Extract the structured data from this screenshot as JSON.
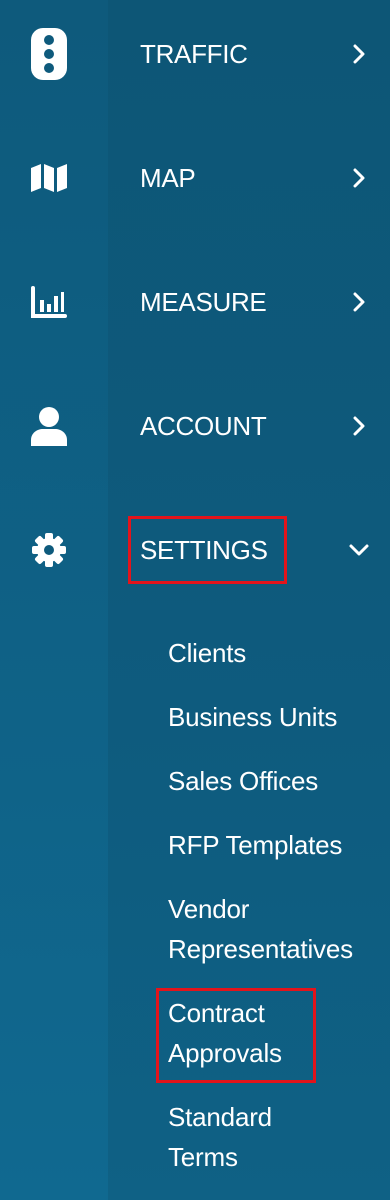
{
  "nav": {
    "items": [
      {
        "label": "TRAFFIC",
        "icon": "traffic-light-icon",
        "chevron": "chevron-right-icon"
      },
      {
        "label": "MAP",
        "icon": "map-icon",
        "chevron": "chevron-right-icon"
      },
      {
        "label": "MEASURE",
        "icon": "bar-chart-icon",
        "chevron": "chevron-right-icon"
      },
      {
        "label": "ACCOUNT",
        "icon": "user-icon",
        "chevron": "chevron-right-icon"
      },
      {
        "label": "SETTINGS",
        "icon": "gear-icon",
        "chevron": "chevron-down-icon",
        "expanded": true
      }
    ]
  },
  "settings_submenu": {
    "items": [
      {
        "label": "Clients"
      },
      {
        "label": "Business Units"
      },
      {
        "label": "Sales Offices"
      },
      {
        "label": "RFP Templates"
      },
      {
        "label": "Vendor Representatives",
        "line1": "Vendor",
        "line2": "Representatives"
      },
      {
        "label": "Contract Approvals",
        "line1": "Contract",
        "line2": "Approvals"
      },
      {
        "label": "Standard Terms",
        "line1": "Standard",
        "line2": "Terms"
      }
    ]
  },
  "colors": {
    "highlight": "#e3141b",
    "text": "#ffffff"
  }
}
